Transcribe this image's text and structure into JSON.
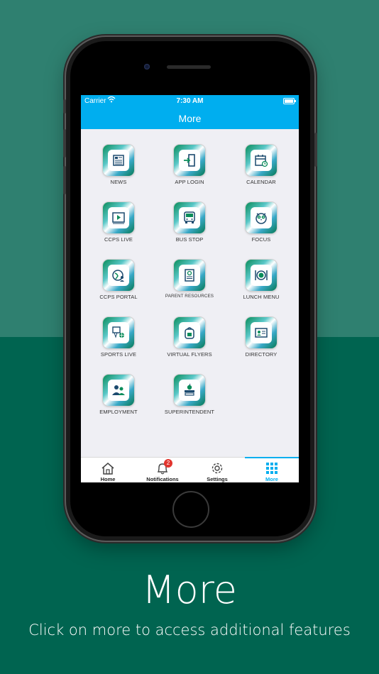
{
  "status": {
    "carrier": "Carrier",
    "time": "7:30 AM"
  },
  "header": {
    "title": "More"
  },
  "tiles": [
    {
      "label": "NEWS",
      "icon": "newspaper-icon"
    },
    {
      "label": "APP LOGIN",
      "icon": "login-door-icon"
    },
    {
      "label": "CALENDAR",
      "icon": "calendar-icon"
    },
    {
      "label": "CCPS LIVE",
      "icon": "video-player-icon"
    },
    {
      "label": "BUS STOP",
      "icon": "school-bus-icon"
    },
    {
      "label": "FOCUS",
      "icon": "owl-icon"
    },
    {
      "label": "CCPS PORTAL",
      "icon": "globe-user-icon"
    },
    {
      "label": "PARENT RESOURCES",
      "icon": "document-check-icon"
    },
    {
      "label": "LUNCH MENU",
      "icon": "plate-cutlery-icon"
    },
    {
      "label": "SPORTS LIVE",
      "icon": "basketball-hoop-icon"
    },
    {
      "label": "VIRTUAL FLYERS",
      "icon": "backpack-icon"
    },
    {
      "label": "DIRECTORY",
      "icon": "contact-card-icon"
    },
    {
      "label": "EMPLOYMENT",
      "icon": "people-icon"
    },
    {
      "label": "SUPERINTENDENT",
      "icon": "books-apple-icon"
    }
  ],
  "tabbar": {
    "home": "Home",
    "notifications": "Notifications",
    "notifications_badge": "2",
    "settings": "Settings",
    "more": "More"
  },
  "caption": {
    "title": "More",
    "subtitle": "Click on more to access additional features"
  },
  "colors": {
    "accent": "#00aeef",
    "background_top": "#2f8070",
    "background_bottom": "#006450",
    "badge": "#e2352e"
  }
}
